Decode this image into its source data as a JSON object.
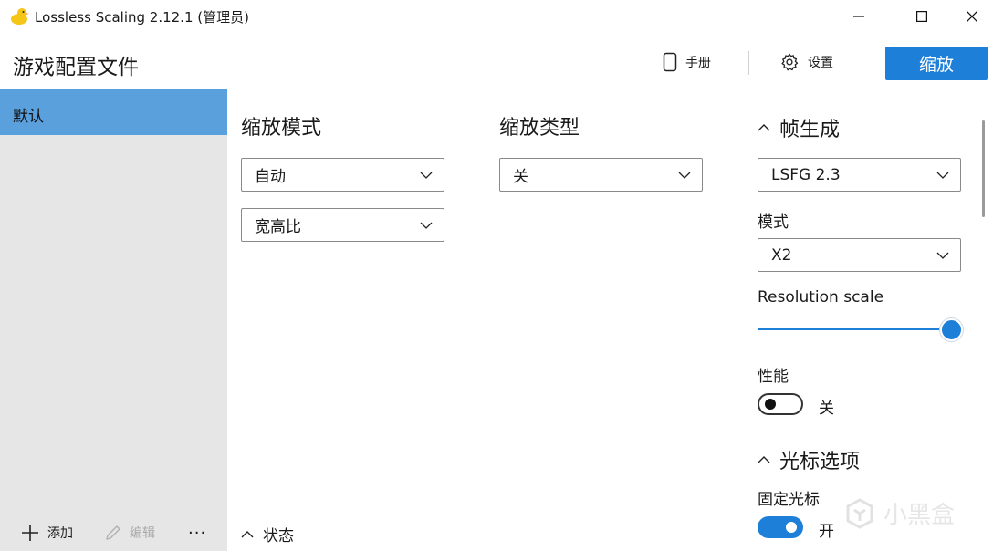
{
  "window": {
    "title": "Lossless Scaling 2.12.1 (管理员)",
    "app_icon": "duck-icon",
    "controls": [
      "minimize-icon",
      "maximize-icon",
      "close-icon"
    ]
  },
  "header": {
    "page_title": "游戏配置文件",
    "manual_label": "手册",
    "settings_label": "设置",
    "scale_button_label": "缩放"
  },
  "sidebar": {
    "profiles": [
      {
        "label": "默认",
        "selected": true
      }
    ],
    "add_label": "添加",
    "edit_label": "编辑",
    "more_label": "···"
  },
  "scaling_mode": {
    "title": "缩放模式",
    "mode_value": "自动",
    "aspect_value": "宽高比"
  },
  "scaling_type": {
    "title": "缩放类型",
    "value": "关"
  },
  "frame_gen": {
    "title": "帧生成",
    "expanded": true,
    "type_value": "LSFG 2.3",
    "mode_label": "模式",
    "mode_value": "X2",
    "resolution_scale_label": "Resolution scale",
    "resolution_scale_level": 1.0,
    "performance_label": "性能",
    "performance_state": "关",
    "performance_on": false
  },
  "cursor_options": {
    "title": "光标选项",
    "expanded": true,
    "lock_cursor_label": "固定光标",
    "lock_cursor_state": "开",
    "lock_cursor_on": true
  },
  "status": {
    "label": "状态"
  },
  "watermark": {
    "text": "小黑盒"
  },
  "colors": {
    "accent": "#1e7fd8",
    "sidebar_bg": "#e6e6e6",
    "selected_profile": "#5aa0dd"
  }
}
